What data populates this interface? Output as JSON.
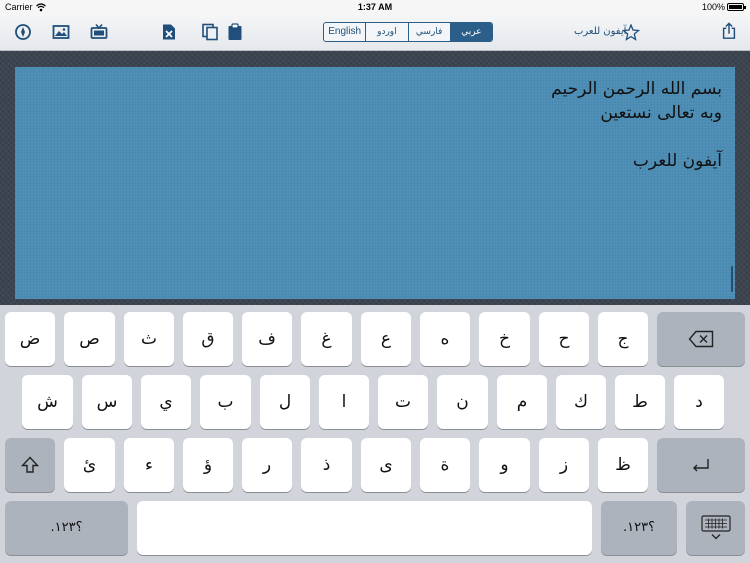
{
  "status_bar": {
    "carrier": "Carrier",
    "time": "1:37 AM",
    "battery": "100%"
  },
  "toolbar": {
    "icons_left": [
      "compass-icon",
      "image-icon",
      "tv-icon"
    ],
    "icons_mid": [
      "delete-file-icon",
      "copy-icon",
      "clipboard-icon"
    ],
    "languages": [
      {
        "label": "English",
        "active": false
      },
      {
        "label": "اوردو",
        "active": false
      },
      {
        "label": "فارسي",
        "active": false
      },
      {
        "label": "عربي",
        "active": true
      }
    ],
    "brand_name": "آيفون للعرب",
    "share_icon": "share-icon"
  },
  "editor": {
    "lines": [
      "بسم الله الرحمن الرحيم",
      "وبه تعالى نستعين",
      "",
      "آيفون للعرب"
    ]
  },
  "keyboard": {
    "row1": [
      "ض",
      "ص",
      "ث",
      "ق",
      "ف",
      "غ",
      "ع",
      "ه",
      "خ",
      "ح",
      "ج"
    ],
    "row2": [
      "ش",
      "س",
      "ي",
      "ب",
      "ل",
      "ا",
      "ت",
      "ن",
      "م",
      "ك",
      "ط",
      "د"
    ],
    "row3": [
      "ئ",
      "ء",
      "ؤ",
      "ر",
      "ذ",
      "ى",
      "ة",
      "و",
      "ز",
      "ظ"
    ],
    "numbers_left": ".؟١٢٣",
    "numbers_right": ".؟١٢٣",
    "space_label": ""
  }
}
